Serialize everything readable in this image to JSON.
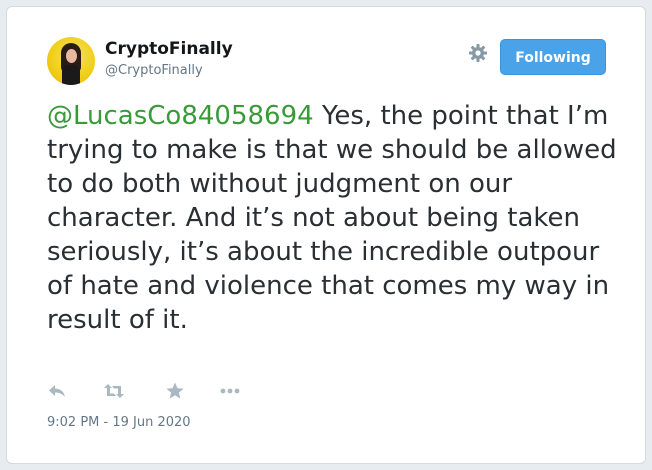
{
  "author": {
    "display_name": "CryptoFinally",
    "handle": "@CryptoFinally",
    "avatar_icon": "avatar-photo"
  },
  "follow_button": {
    "label": "Following",
    "color": "#4aa3e8"
  },
  "tweet": {
    "mention": "@LucasCo84058694",
    "body": " Yes, the point that I’m trying to make is that we should be allowed to do both without judgment on our character. And it’s not about being taken seriously, it’s about the incredible outpour of hate and violence that comes my way in result of it.",
    "mention_color": "#3a9a3a"
  },
  "actions": {
    "reply_icon": "reply-icon",
    "retweet_icon": "retweet-icon",
    "like_icon": "star-icon",
    "more_icon": "more-icon"
  },
  "timestamp": "9:02 PM - 19 Jun 2020"
}
